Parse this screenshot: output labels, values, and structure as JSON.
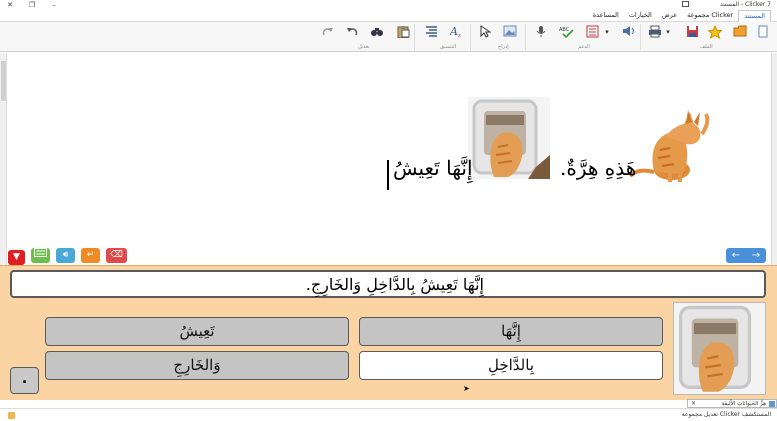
{
  "window": {
    "title": "Clicker 7 - المستند"
  },
  "menu": [
    {
      "label": "المستند",
      "active": true
    },
    {
      "label": "مجموعة Clicker",
      "active": false
    },
    {
      "label": "عرض",
      "active": false
    },
    {
      "label": "الخيارات",
      "active": false
    },
    {
      "label": "المساعدة",
      "active": false
    }
  ],
  "ribbon": {
    "groups": {
      "file": "الملف",
      "support": "الدعم",
      "insert": "إدراج",
      "format": "التنسيق",
      "edit": "تعديل"
    }
  },
  "document": {
    "sentence_1": "هَذِهِ هِرَّةٌ.",
    "sentence_2": "إِنَّهَا تَعِيشُ"
  },
  "sentence_bar": {
    "text": "إِنَّهَا تَعِيشُ بِالدَّاخِلِ وَالخَارِجِ."
  },
  "word_grid": {
    "cells": [
      {
        "label": "إِنَّهَا",
        "state": "used"
      },
      {
        "label": "تَعِيشُ",
        "state": "used"
      },
      {
        "label": "بِالدَّاخِلِ",
        "state": "available"
      },
      {
        "label": "وَالخَارِجِ",
        "state": "used"
      }
    ],
    "period": "."
  },
  "tools": {
    "icons": [
      "delete-word-icon",
      "enter-icon",
      "speak-icon",
      "keyboard-icon",
      "collapse-icon"
    ],
    "colors": {
      "delete": "#e04a4a",
      "enter": "#f08a24",
      "speak": "#4aa8d8",
      "keyboard": "#6cbf4a",
      "collapse": "#e02020",
      "nav": "#4a90d9"
    },
    "nav_prev": "←",
    "nav_next": "→"
  },
  "thumbnail": {
    "tab_label": "هِرٌّ الحَيَوانَاتِ الأَلِيفَةِ",
    "close": "×"
  },
  "status": {
    "text": "المستكشف Clicker تعديل مجموعة"
  }
}
